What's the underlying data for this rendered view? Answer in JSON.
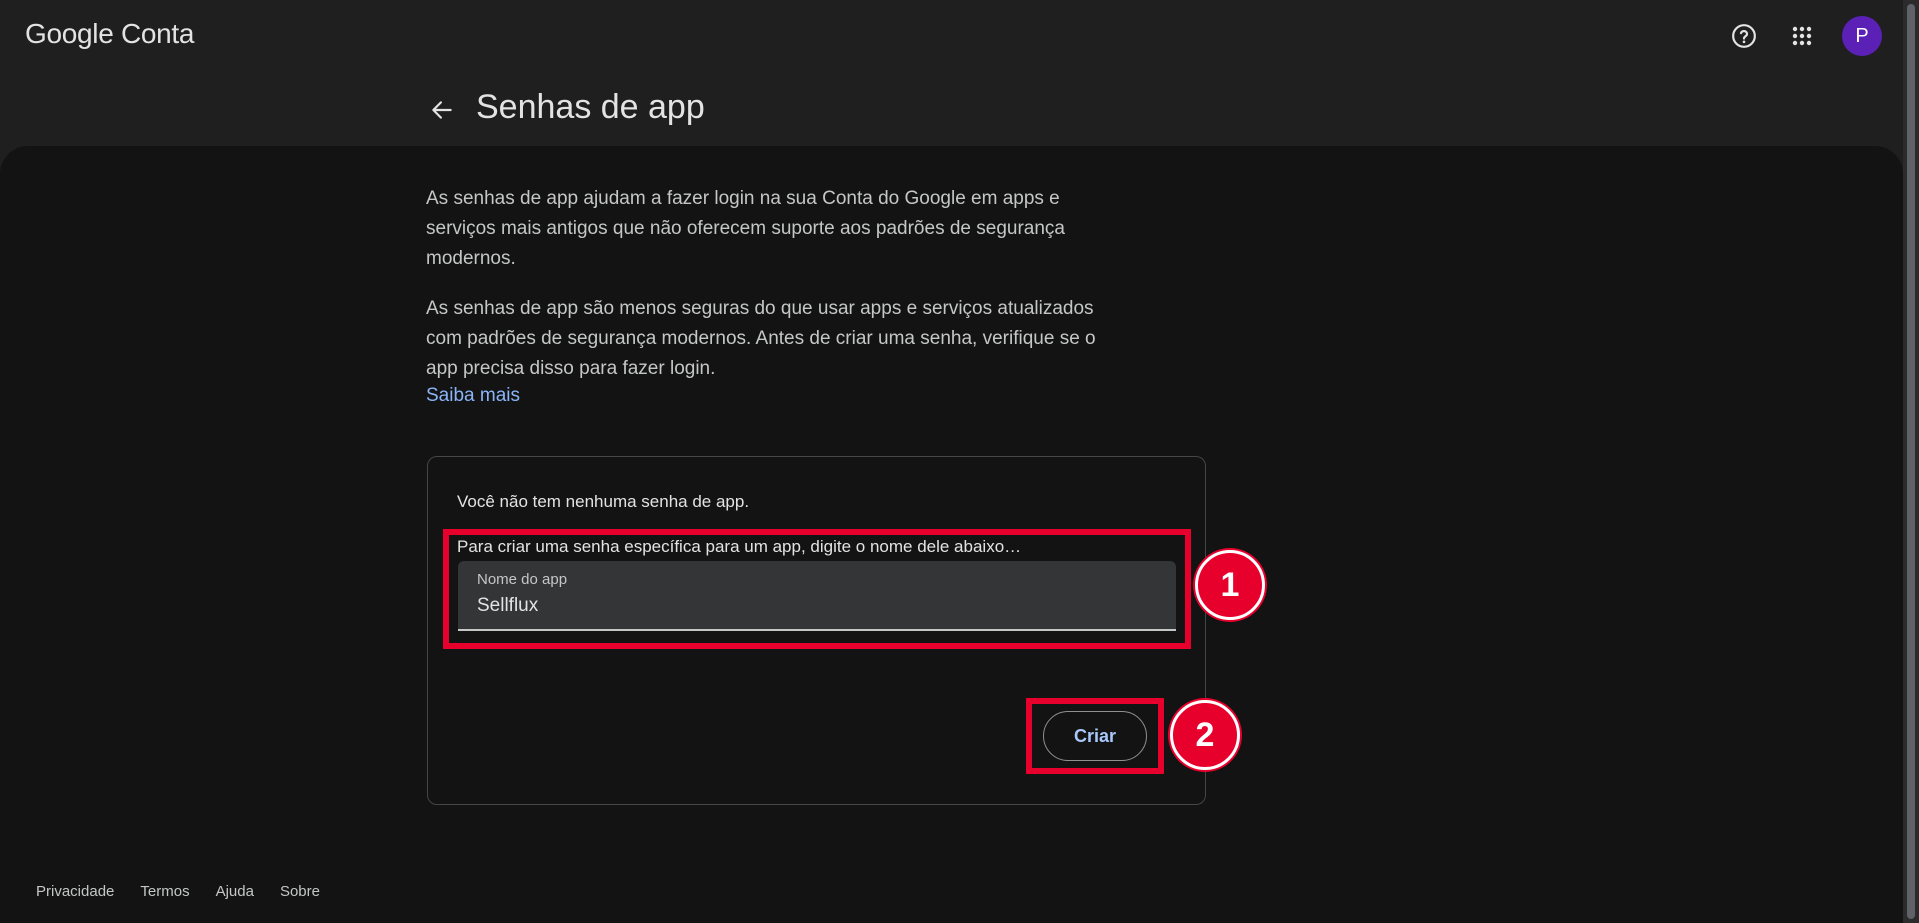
{
  "header": {
    "logo_text": "Google Conta",
    "help_icon": "help-circle-icon",
    "apps_icon": "apps-grid-icon",
    "avatar_letter": "P",
    "avatar_color": "#5b21b6"
  },
  "page": {
    "title": "Senhas de app",
    "back_icon": "arrow-left-icon"
  },
  "intro": {
    "paragraph1": "As senhas de app ajudam a fazer login na sua Conta do Google em apps e serviços mais antigos que não oferecem suporte aos padrões de segurança modernos.",
    "paragraph2": "As senhas de app são menos seguras do que usar apps e serviços atualizados com padrões de segurança modernos. Antes de criar uma senha, verifique se o app precisa disso para fazer login.",
    "learn_more": "Saiba mais"
  },
  "card": {
    "no_passwords": "Você não tem nenhuma senha de app.",
    "instruction": "Para criar uma senha específica para um app, digite o nome dele abaixo…",
    "field_label": "Nome do app",
    "field_value": "Sellflux",
    "create_button": "Criar"
  },
  "annotations": {
    "badge1": "1",
    "badge2": "2",
    "highlight_color": "#e8002d"
  },
  "footer": {
    "links": [
      "Privacidade",
      "Termos",
      "Ajuda",
      "Sobre"
    ]
  }
}
